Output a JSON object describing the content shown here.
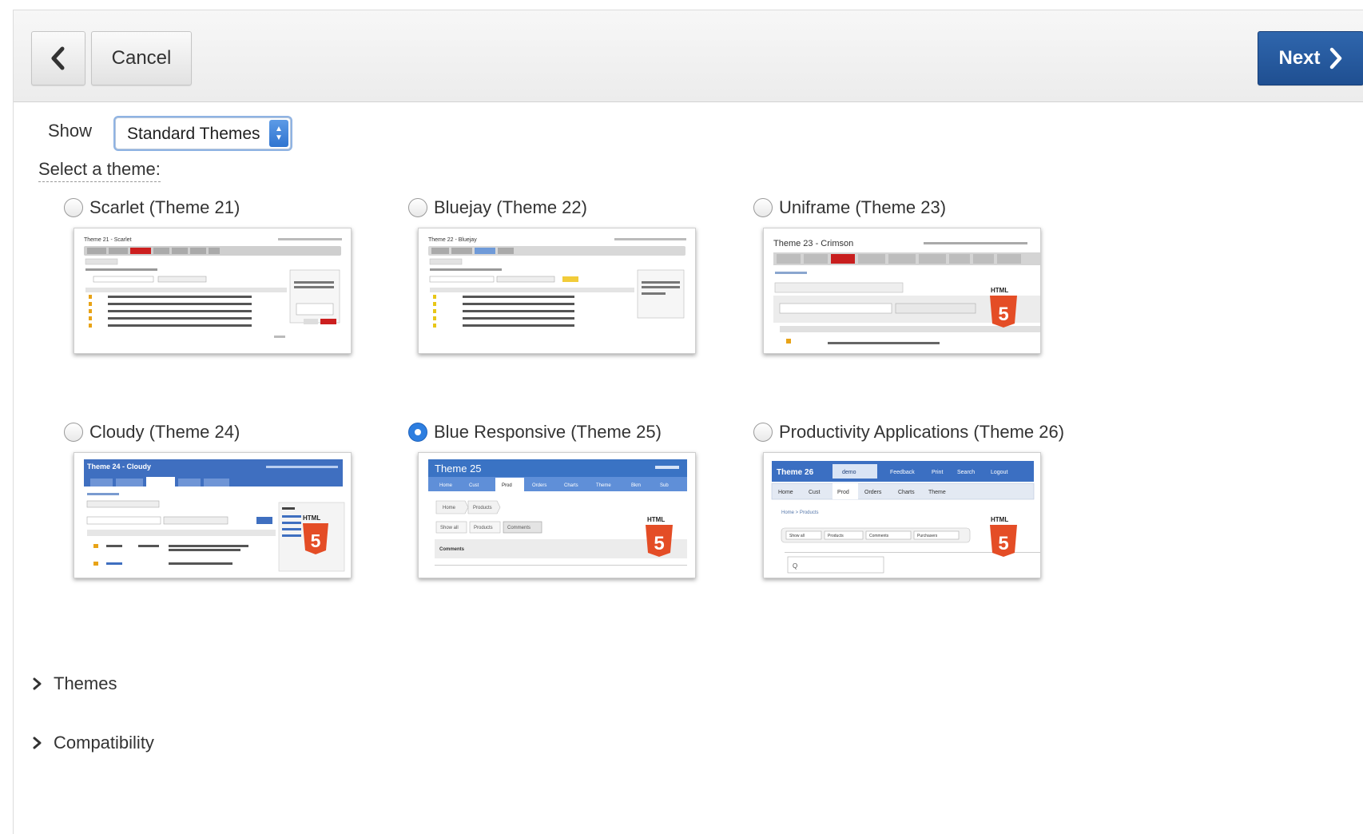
{
  "toolbar": {
    "cancel_label": "Cancel",
    "next_label": "Next"
  },
  "show": {
    "label": "Show",
    "selected": "Standard Themes"
  },
  "select_prompt": "Select a theme:",
  "themes": [
    {
      "label": "Scarlet (Theme 21)",
      "checked": false
    },
    {
      "label": "Bluejay (Theme 22)",
      "checked": false
    },
    {
      "label": "Uniframe (Theme 23)",
      "checked": false
    },
    {
      "label": "Cloudy (Theme 24)",
      "checked": false
    },
    {
      "label": "Blue Responsive (Theme 25)",
      "checked": true
    },
    {
      "label": "Productivity Applications (Theme 26)",
      "checked": false
    }
  ],
  "thumbnails": {
    "t21_title": "Theme 21 - Scarlet",
    "t22_title": "Theme 22 - Bluejay",
    "t23_title": "Theme 23 - Crimson",
    "t23_badge": "HTML",
    "t24_title": "Theme 24 - Cloudy",
    "t24_badge": "HTML",
    "t25_title": "Theme 25",
    "t25_badge": "HTML",
    "t25_tabs": [
      "Home",
      "Cust",
      "Prod",
      "Orders",
      "Charts",
      "Theme",
      "Bkm",
      "Sub"
    ],
    "t25_crumbs": [
      "Home",
      "Products"
    ],
    "t25_subtabs": [
      "Show all",
      "Products",
      "Comments"
    ],
    "t25_section": "Comments",
    "t26_title": "Theme 26",
    "t26_badge": "HTML",
    "t26_header_links": [
      "demo",
      "Feedback",
      "Print",
      "Search",
      "Logout"
    ],
    "t26_tabs": [
      "Home",
      "Cust",
      "Prod",
      "Orders",
      "Charts",
      "Theme"
    ],
    "t26_crumbs": "Home > Products",
    "t26_subtabs": [
      "Show all",
      "Products",
      "Comments",
      "Purchasers"
    ],
    "t26_search": "Q"
  },
  "sections": [
    {
      "label": "Themes"
    },
    {
      "label": "Compatibility"
    }
  ],
  "colors": {
    "next_button": "#1f4f91",
    "scarlet_red": "#cc1f1f",
    "crimson_red": "#c81e1e",
    "bluejay_blue": "#6f9ad8",
    "cloudy_blue": "#3f6fc0",
    "responsive_blue": "#3a73c4",
    "html5_orange": "#e44d26",
    "radio_checked": "#2d7ee0"
  }
}
